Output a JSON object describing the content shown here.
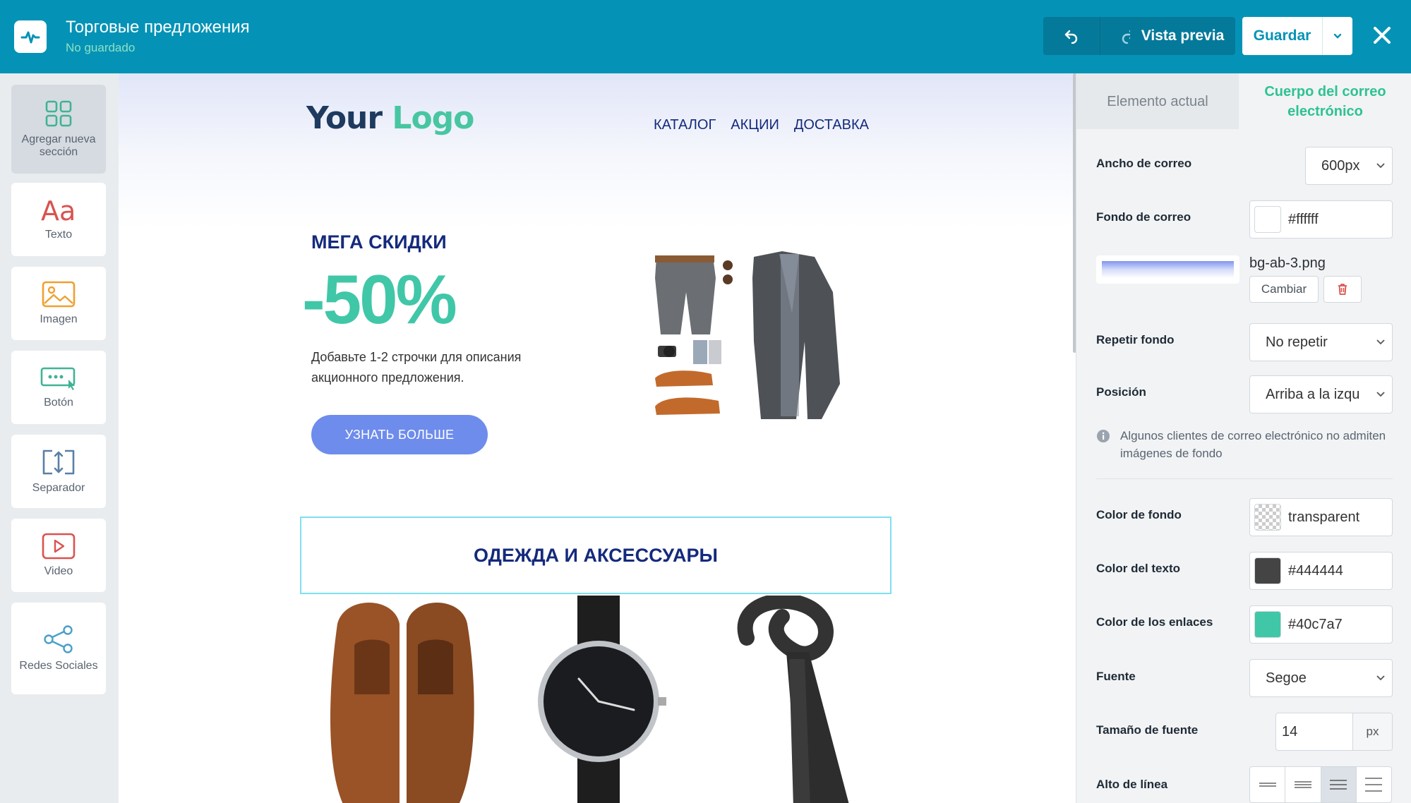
{
  "header": {
    "title": "Торговые предложения",
    "status": "No guardado",
    "preview_label": "Vista previa",
    "save_label": "Guardar"
  },
  "sidebar": {
    "tools": [
      {
        "label": "Agregar nueva sección",
        "icon": "grid-icon"
      },
      {
        "label": "Texto",
        "icon": "text-icon"
      },
      {
        "label": "Imagen",
        "icon": "image-icon"
      },
      {
        "label": "Botón",
        "icon": "button-icon"
      },
      {
        "label": "Separador",
        "icon": "separator-icon"
      },
      {
        "label": "Video",
        "icon": "video-icon"
      },
      {
        "label": "Redes Sociales",
        "icon": "share-icon"
      }
    ]
  },
  "email": {
    "logo_part1": "Your",
    "logo_part2": "Logo",
    "nav": [
      "КАТАЛОГ",
      "АКЦИИ",
      "ДОСТАВКА"
    ],
    "promo_title": "МЕГА СКИДКИ",
    "discount": "-50%",
    "description": "Добавьте 1-2 строчки для описания акционного предложения.",
    "cta": "УЗНАТЬ БОЛЬШЕ",
    "section_title": "ОДЕЖДА И АКСЕССУАРЫ"
  },
  "panel": {
    "tabs": [
      "Elemento actual",
      "Cuerpo del correo electrónico"
    ],
    "email_width_label": "Ancho de correo",
    "email_width_value": "600px",
    "email_bg_label": "Fondo de correo",
    "email_bg_value": "#ffffff",
    "bg_image_name": "bg-ab-3.png",
    "change_label": "Cambiar",
    "repeat_label": "Repetir fondo",
    "repeat_value": "No repetir",
    "position_label": "Posición",
    "position_value": "Arriba a la izqu",
    "info_text": "Algunos clientes de correo electrónico no admiten imágenes de fondo",
    "bg_color_label": "Color de fondo",
    "bg_color_value": "transparent",
    "text_color_label": "Color del texto",
    "text_color_value": "#444444",
    "link_color_label": "Color de los enlaces",
    "link_color_value": "#40c7a7",
    "font_label": "Fuente",
    "font_value": "Segoe",
    "font_size_label": "Tamaño de fuente",
    "font_size_value": "14",
    "font_size_unit": "px",
    "line_height_label": "Alto de línea"
  },
  "colors": {
    "header_bg": "#0493b6",
    "accent_green": "#40c7a7",
    "text_color": "#444444",
    "navy": "#142a7c",
    "cta_bg": "#6e8cec"
  }
}
